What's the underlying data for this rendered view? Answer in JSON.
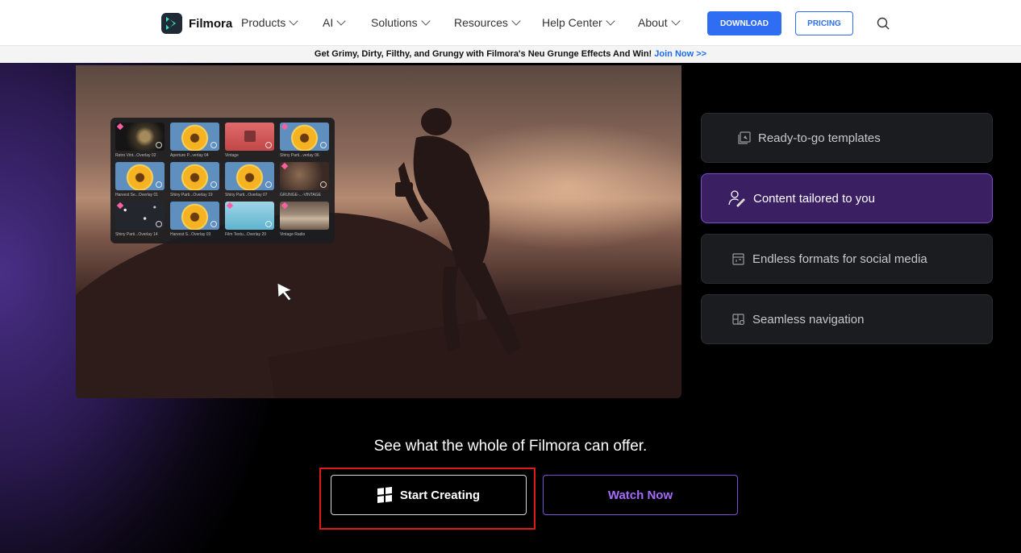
{
  "nav": {
    "logo_text": "Filmora",
    "menu": [
      {
        "label": "Products"
      },
      {
        "label": "AI"
      },
      {
        "label": "Solutions"
      },
      {
        "label": "Resources"
      },
      {
        "label": "Help Center"
      },
      {
        "label": "About"
      }
    ],
    "download_label": "DOWNLOAD",
    "pricing_label": "PRICING",
    "search_icon": "search-icon"
  },
  "banner": {
    "text": "Get Grimy, Dirty, Filthy, and Grungy with Filmora's Neu Grunge Effects And Win!",
    "link": "Join Now >>"
  },
  "panel": {
    "thumbs": [
      {
        "label": "Retro Vint...Overlay 02"
      },
      {
        "label": "Aperture P...verlay 04"
      },
      {
        "label": "Vintage"
      },
      {
        "label": "Shiny Parti...verlay 06"
      },
      {
        "label": "Harvest Se...Overlay 01"
      },
      {
        "label": "Shiny Parti...Overlay 19"
      },
      {
        "label": "Shiny Parti...Overlay 07"
      },
      {
        "label": "GRUNGE-...-VINTAGE"
      },
      {
        "label": "Shiny Parti...Overlay 14"
      },
      {
        "label": "Harvest S...Overlay 03"
      },
      {
        "label": "Film Textu...Overlay 20"
      },
      {
        "label": "Vintage Radio"
      }
    ]
  },
  "features": [
    {
      "label": "Ready-to-go templates",
      "icon": "template-icon",
      "active": false
    },
    {
      "label": "Content tailored to you",
      "icon": "user-edit-icon",
      "active": true
    },
    {
      "label": "Endless formats for social media",
      "icon": "format-icon",
      "active": false
    },
    {
      "label": "Seamless navigation",
      "icon": "navigation-icon",
      "active": false
    }
  ],
  "cta": {
    "tagline": "See what the whole of Filmora can offer.",
    "start_label": "Start Creating",
    "watch_label": "Watch Now"
  },
  "colors": {
    "accent_blue": "#2f6ef3",
    "active_purple": "#3a1f63",
    "watch_purple": "#a56bff",
    "highlight_red": "#e01818"
  }
}
